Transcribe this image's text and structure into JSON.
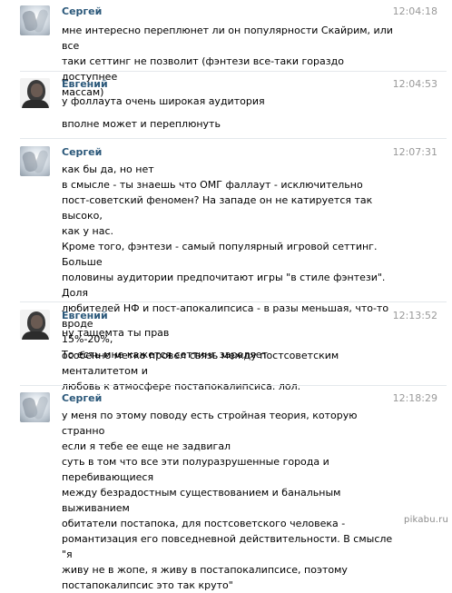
{
  "messages": [
    {
      "author": "Сергей",
      "time": "12:04:18",
      "paragraphs": [
        "мне интересно переплюнет ли он популярности Скайрим, или все\nтаки сеттинг не позволит (фэнтези все-таки гораздо доступнее\nмассам)"
      ]
    },
    {
      "author": "Евгений",
      "time": "12:04:53",
      "paragraphs": [
        "у фоллаута очень широкая аудитория",
        "вполне может и переплюнуть"
      ]
    },
    {
      "author": "Сергей",
      "time": "12:07:31",
      "paragraphs": [
        "как бы да, но нет\nв смысле - ты знаешь что ОМГ фаллаут - исключительно\nпост-советский феномен? На западе он не катируется так высоко,\nкак у нас.\nКроме того, фэнтези - самый популярный игровой сеттинг. Больше\nполовины аудитории предпочитают игры \"в стиле фэнтези\". Доля\nлюбителей НФ и пост-апокалипсиса - в разы меньшая, что-то вроде\n15%-20%,\nТо есть мне кажется сеттинг зароляет"
      ]
    },
    {
      "author": "Евгений",
      "time": "12:13:52",
      "paragraphs": [
        "ну тащемта ты прав",
        "особенно метко провел связь между постсоветским менталитетом и\nлюбовь к атмосфере постапокалипсиса. лол."
      ]
    },
    {
      "author": "Сергей",
      "time": "12:18:29",
      "paragraphs": [
        "у меня по этому поводу есть стройная теория, которую странно\nесли я тебе ее еще не задвигал\nсуть в том что все эти полуразрушенные города и перебивающиеся\nмежду безрадостным существованием и банальным выживанием\nобитатели постапока, для постсоветского человека -\nромантизация его повседневной действительности. В смысле \"я\nживу не в жопе, я живу в постапокалипсисе, поэтому\nпостапокалипсис это так круто\""
      ]
    }
  ],
  "watermark": "pikabu.ru"
}
